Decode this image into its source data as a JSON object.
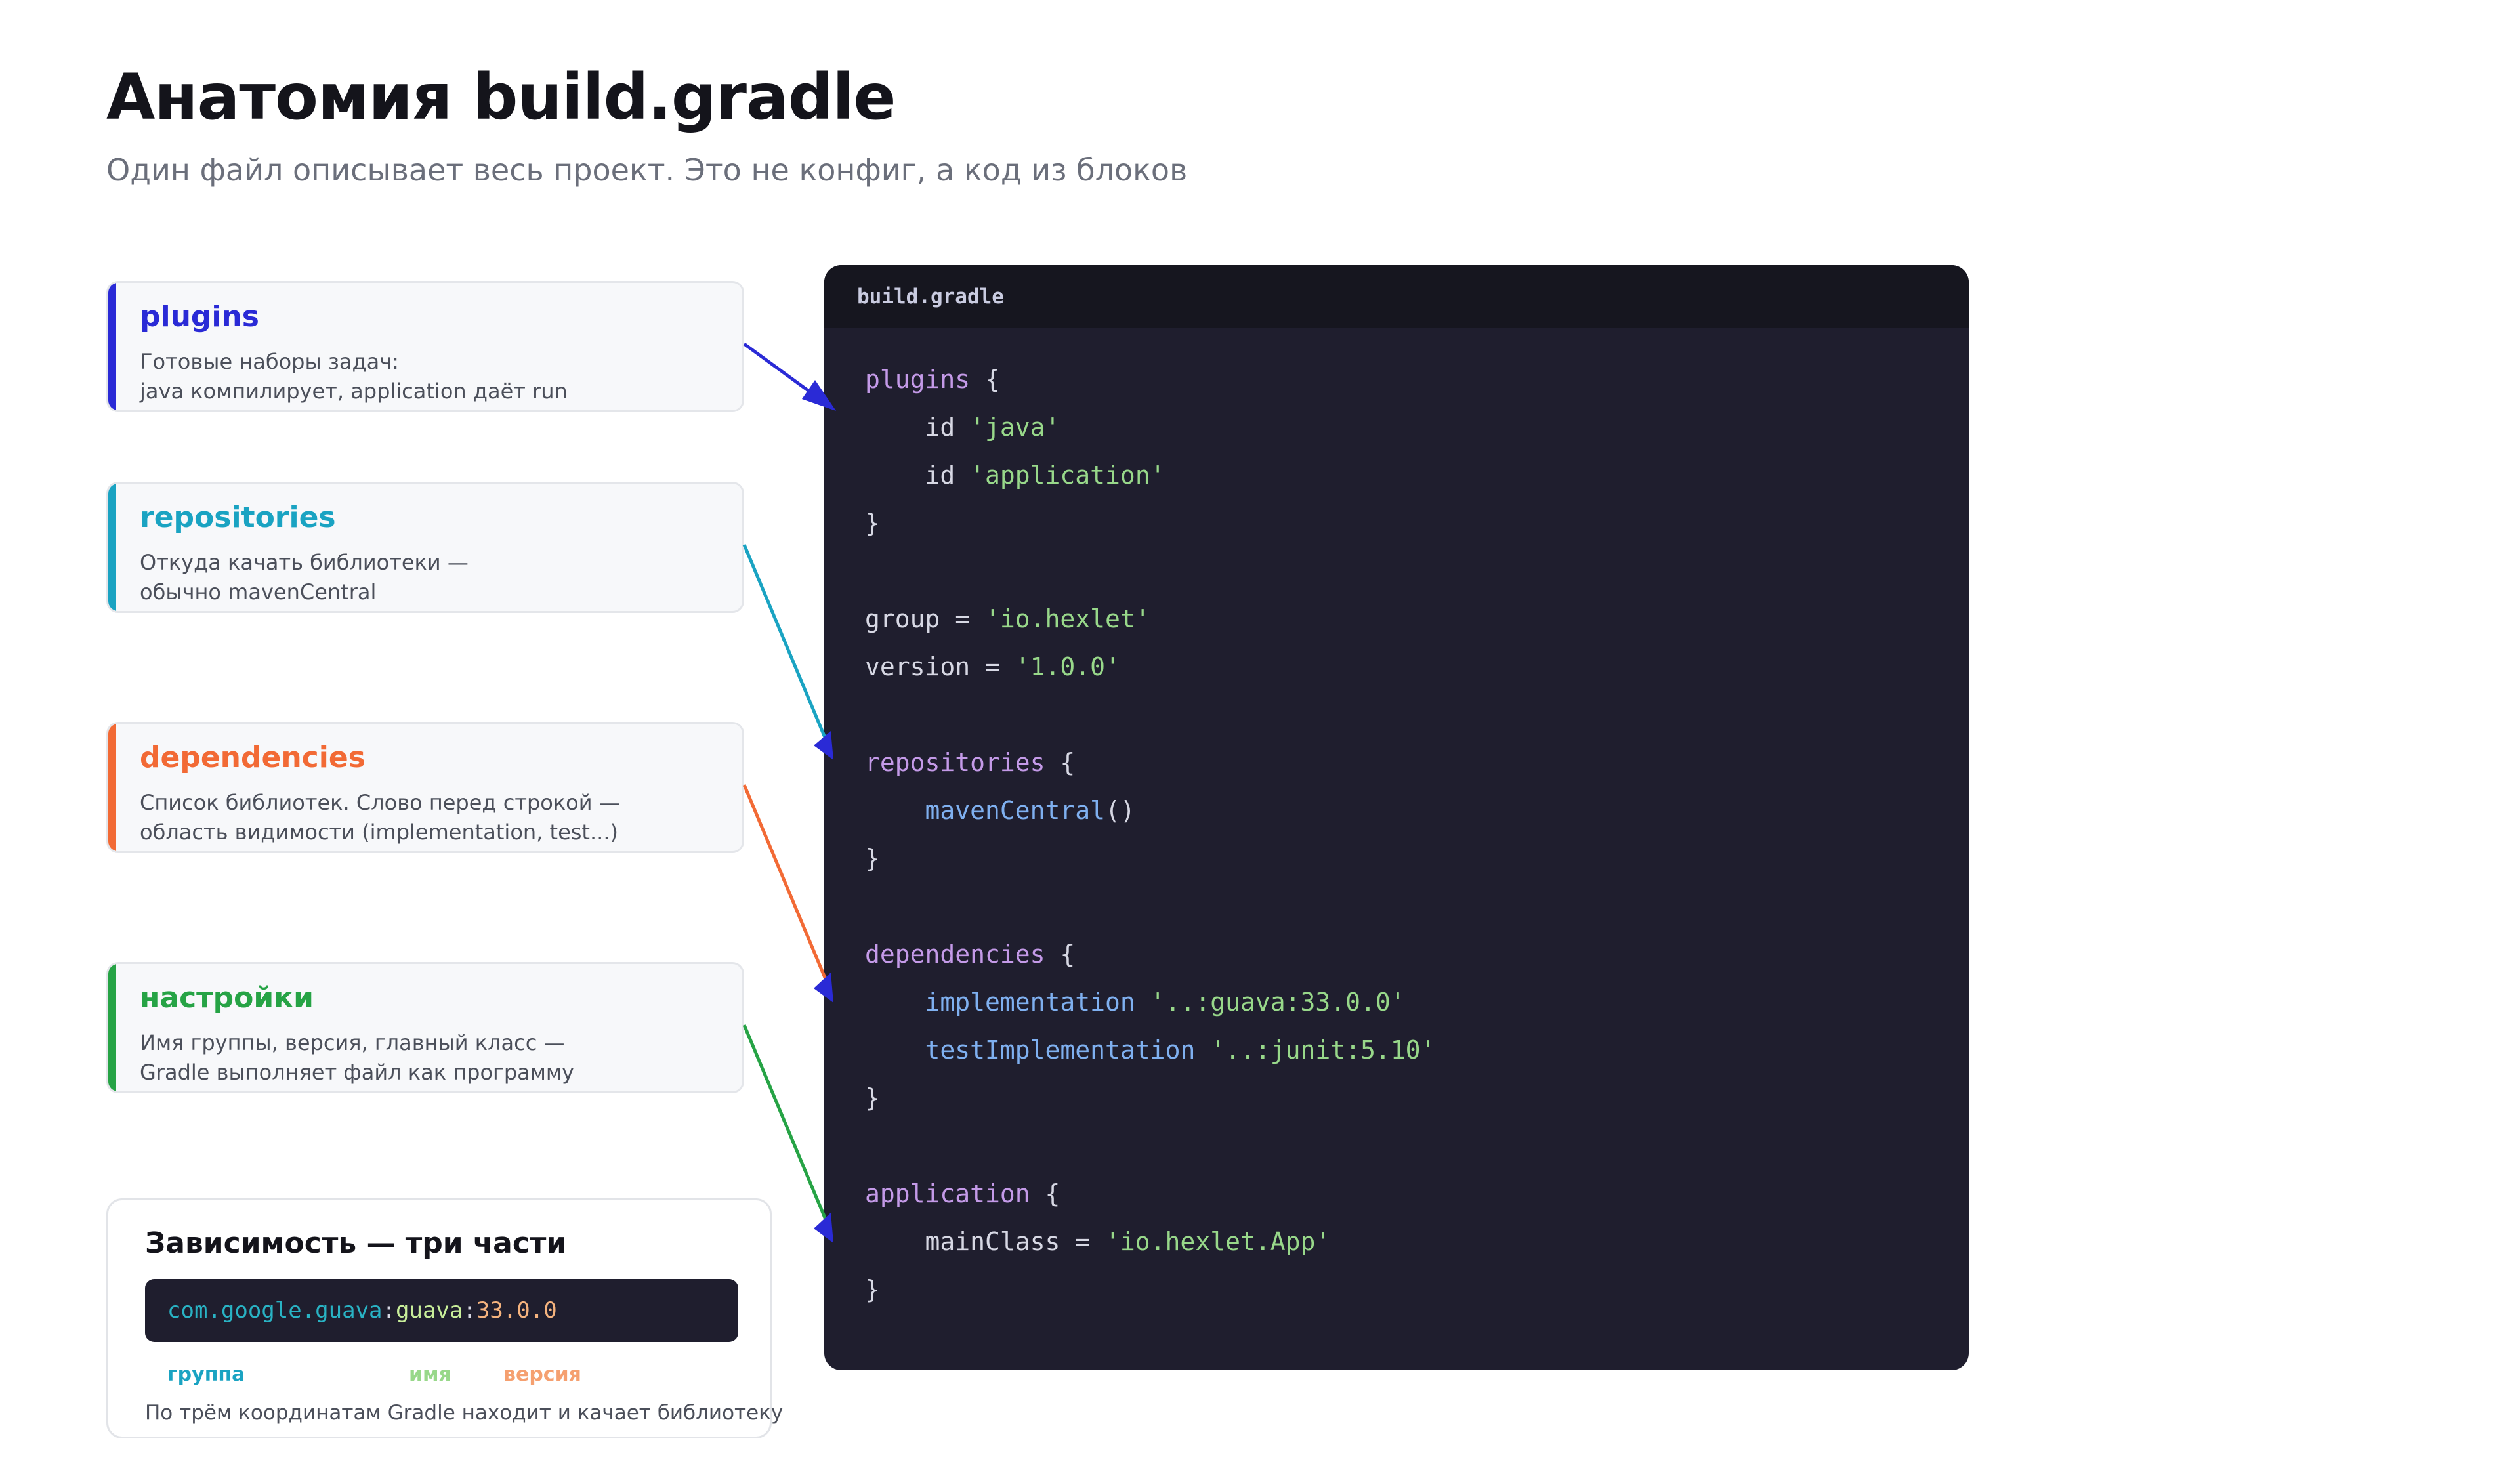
{
  "header": {
    "title": "Анатомия build.gradle",
    "subtitle": "Один файл описывает весь проект. Это не конфиг, а код из блоков"
  },
  "colors": {
    "plugins": "#2a2ad6",
    "repositories": "#1aa3c2",
    "dependencies": "#f26a35",
    "settings": "#26a345"
  },
  "cards": [
    {
      "id": "plugins",
      "title": "plugins",
      "lines": [
        "Готовые наборы задач:",
        "java компилирует, application даёт run"
      ]
    },
    {
      "id": "repositories",
      "title": "repositories",
      "lines": [
        "Откуда качать библиотеки —",
        "обычно mavenCentral"
      ]
    },
    {
      "id": "dependencies",
      "title": "dependencies",
      "lines": [
        "Список библиотек. Слово перед строкой —",
        "область видимости (implementation, test...)"
      ]
    },
    {
      "id": "settings",
      "title": "настройки",
      "lines": [
        "Имя группы, версия, главный класс —",
        "Gradle выполняет файл как программу"
      ]
    }
  ],
  "editor": {
    "filename": "build.gradle",
    "code_lines": [
      [
        [
          "kw",
          "plugins"
        ],
        [
          "p",
          " {"
        ]
      ],
      [
        [
          "p",
          "    id "
        ],
        [
          "str",
          "'java'"
        ]
      ],
      [
        [
          "p",
          "    id "
        ],
        [
          "str",
          "'application'"
        ]
      ],
      [
        [
          "p",
          "}"
        ]
      ],
      [],
      [
        [
          "p",
          "group = "
        ],
        [
          "str",
          "'io.hexlet'"
        ]
      ],
      [
        [
          "p",
          "version = "
        ],
        [
          "str",
          "'1.0.0'"
        ]
      ],
      [],
      [
        [
          "kw",
          "repositories"
        ],
        [
          "p",
          " {"
        ]
      ],
      [
        [
          "p",
          "    "
        ],
        [
          "fn",
          "mavenCentral"
        ],
        [
          "p",
          "()"
        ]
      ],
      [
        [
          "p",
          "}"
        ]
      ],
      [],
      [
        [
          "kw",
          "dependencies"
        ],
        [
          "p",
          " {"
        ]
      ],
      [
        [
          "p",
          "    "
        ],
        [
          "fn",
          "implementation"
        ],
        [
          "p",
          " "
        ],
        [
          "str",
          "'..:guava:33.0.0'"
        ]
      ],
      [
        [
          "p",
          "    "
        ],
        [
          "fn",
          "testImplementation"
        ],
        [
          "p",
          " "
        ],
        [
          "str",
          "'..:junit:5.10'"
        ]
      ],
      [
        [
          "p",
          "}"
        ]
      ],
      [],
      [
        [
          "kw",
          "application"
        ],
        [
          "p",
          " {"
        ]
      ],
      [
        [
          "p",
          "    mainClass = "
        ],
        [
          "str",
          "'io.hexlet.App'"
        ]
      ],
      [
        [
          "p",
          "}"
        ]
      ]
    ]
  },
  "dependency_box": {
    "title": "Зависимость — три части",
    "group": "com.google.guava",
    "sep1": ":",
    "name": "guava",
    "sep2": ":",
    "version": "33.0.0",
    "labels": {
      "group": "группа",
      "name": "имя",
      "version": "версия"
    },
    "note": "По трём координатам Gradle находит и качает библиотеку"
  }
}
